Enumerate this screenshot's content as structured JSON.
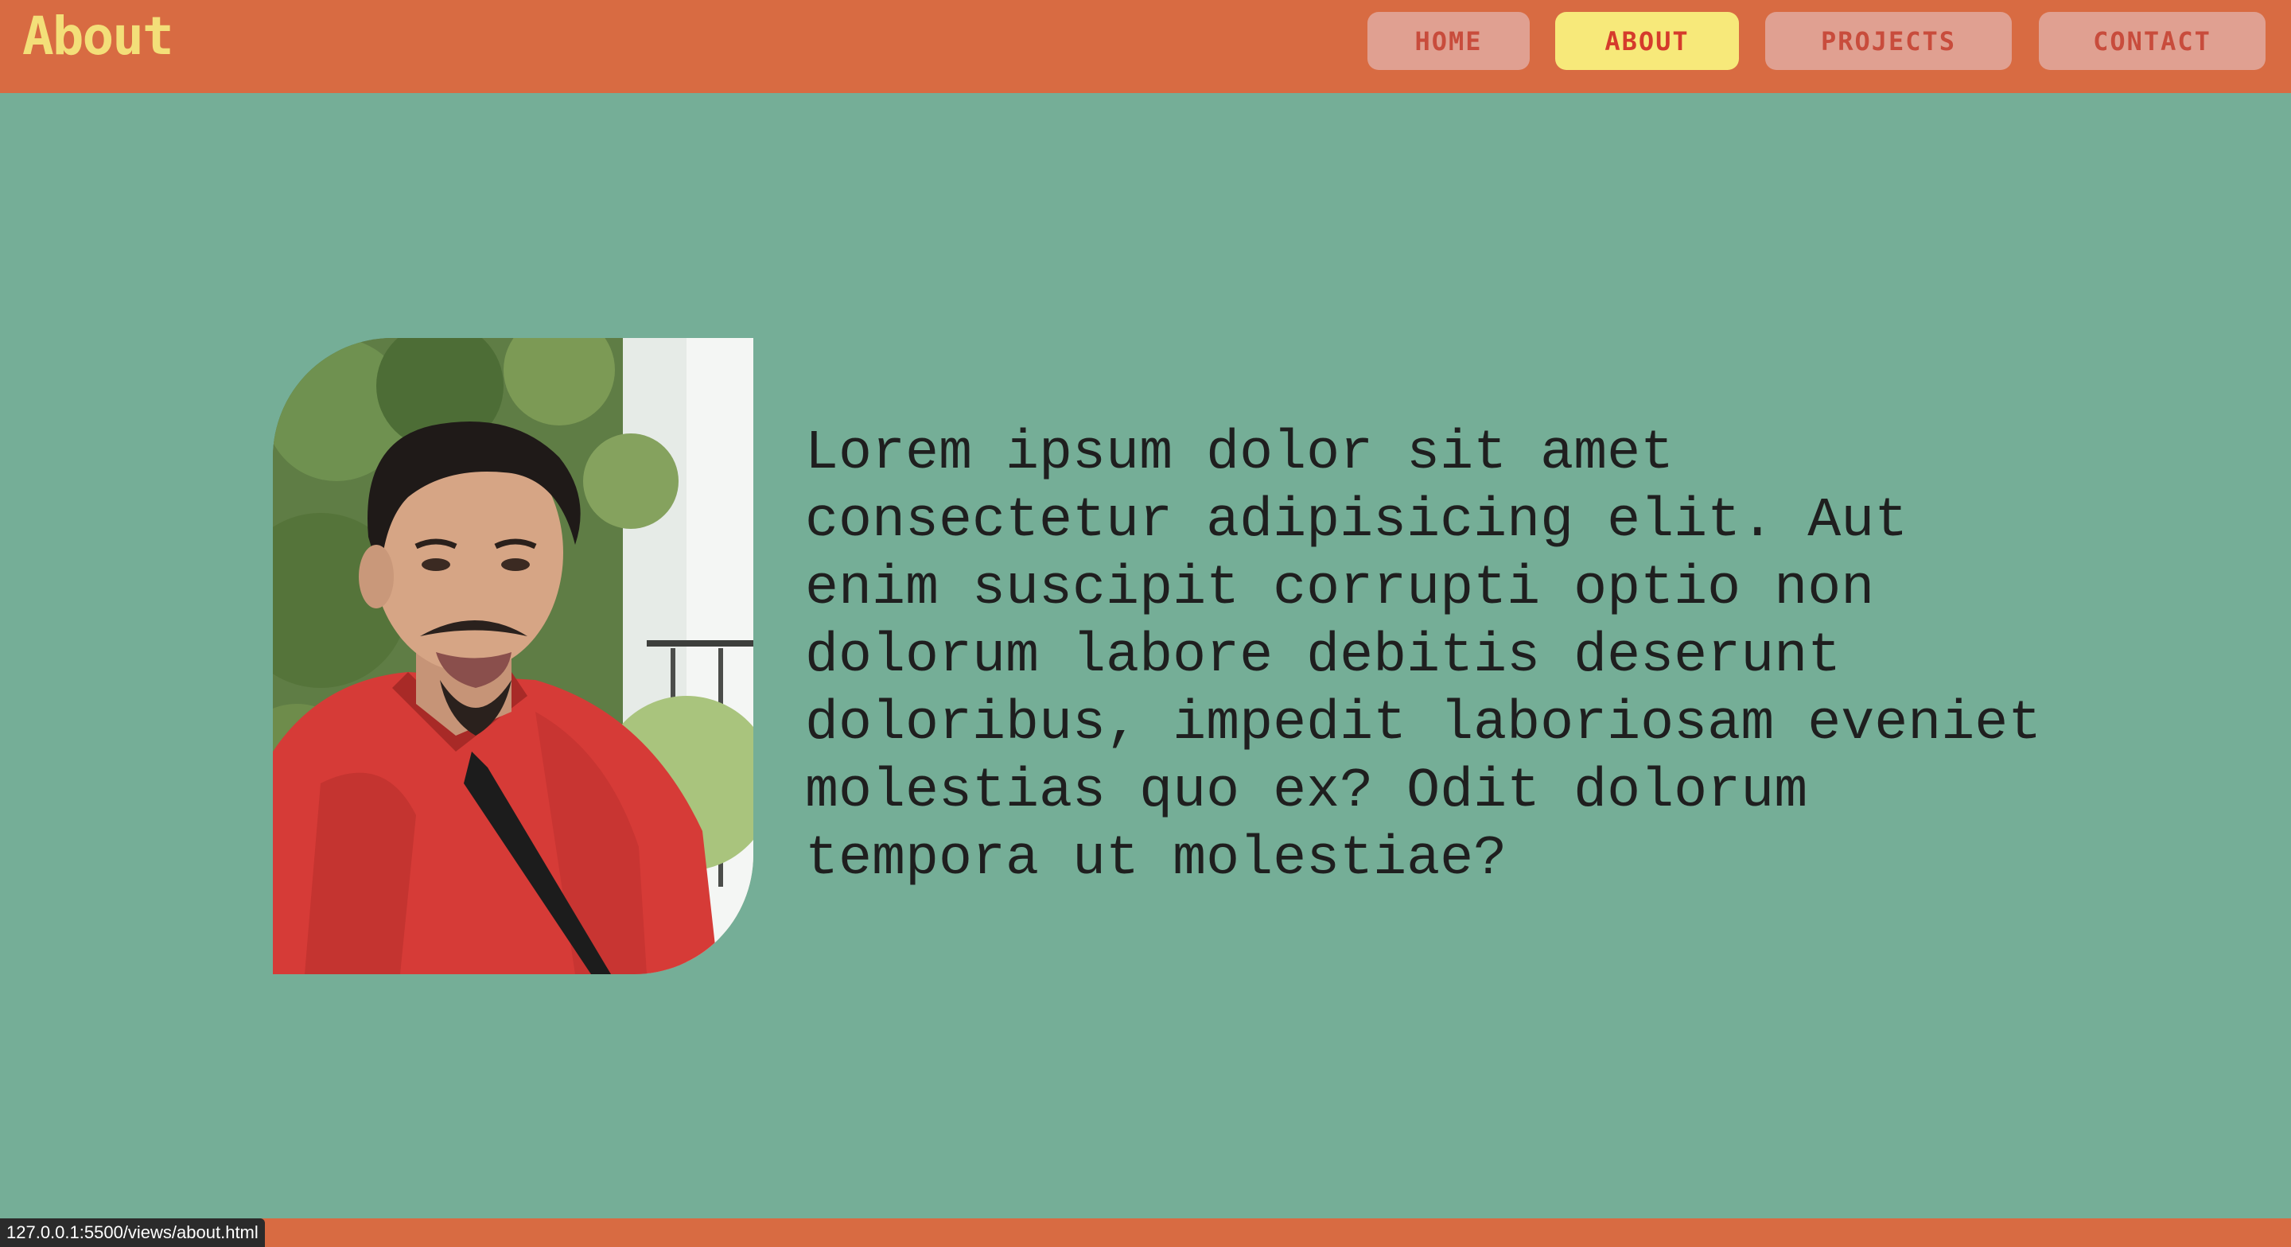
{
  "header": {
    "title": "About",
    "nav": [
      {
        "label": "HOME",
        "active": false
      },
      {
        "label": "ABOUT",
        "active": true
      },
      {
        "label": "PROJECTS",
        "active": false
      },
      {
        "label": "CONTACT",
        "active": false
      }
    ]
  },
  "main": {
    "bio_text": "Lorem ipsum dolor sit amet consectetur adipisicing elit. Aut enim suscipit corrupti optio non dolorum labore debitis deserunt doloribus, impedit laboriosam eveniet molestias quo ex? Odit dolorum tempora ut molestiae?"
  },
  "status_bar": {
    "url": "127.0.0.1:5500/views/about.html"
  },
  "colors": {
    "header_bg": "#d86b42",
    "page_bg": "#75ae97",
    "title_color": "#f3df79",
    "nav_bg": "#e0a091",
    "nav_active_bg": "#f7e97a",
    "nav_text": "#c84c3c"
  }
}
